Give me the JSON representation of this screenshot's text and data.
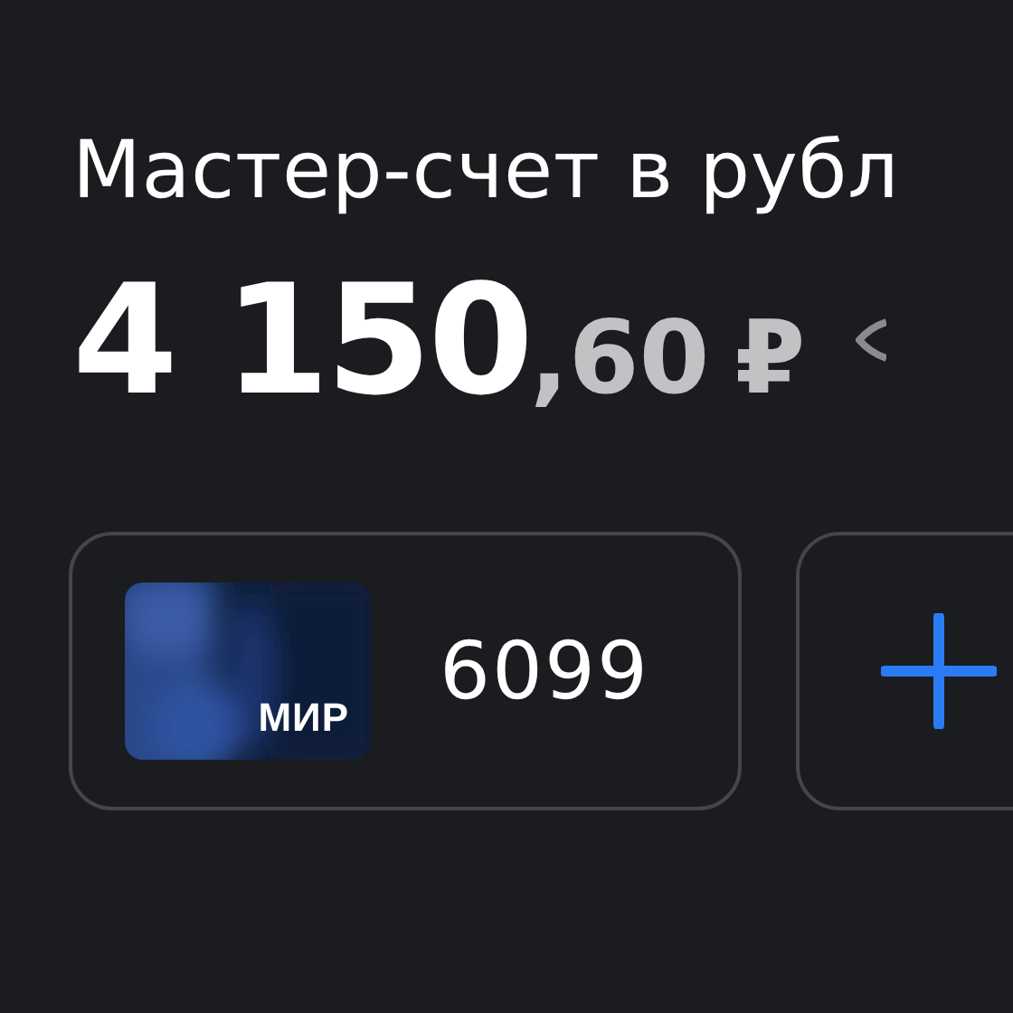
{
  "account": {
    "title": "Мастер-счет в рубл",
    "balance": {
      "integer": "4 150",
      "fraction": ",60",
      "currency": "₽"
    }
  },
  "cards": [
    {
      "kind": "card",
      "brand": "МИР",
      "number": "6099"
    },
    {
      "kind": "add"
    }
  ]
}
